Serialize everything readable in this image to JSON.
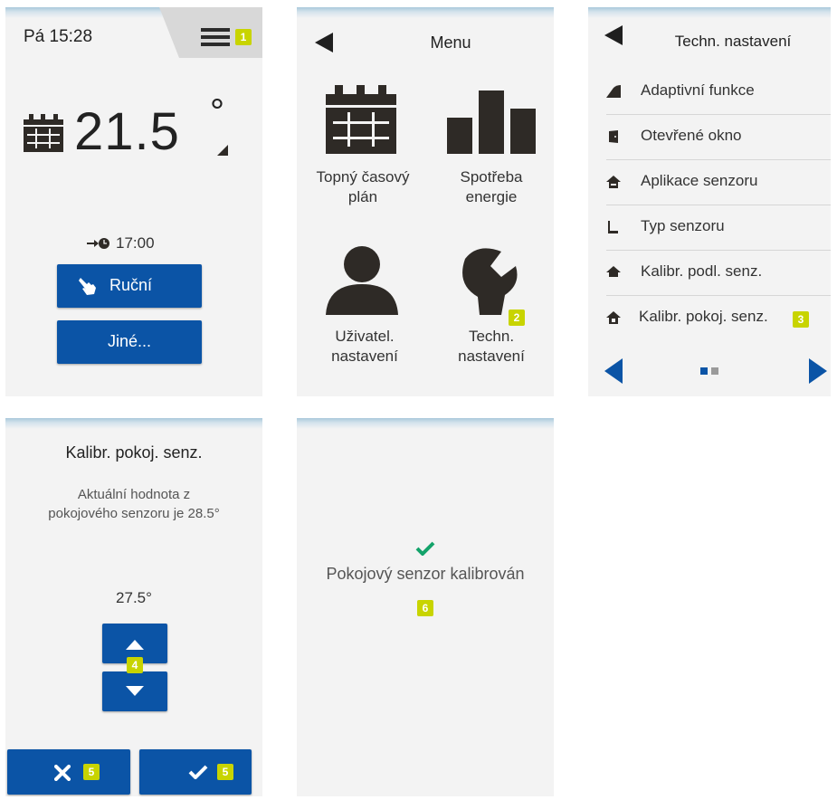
{
  "screen1": {
    "time": "Pá 15:28",
    "badge_menu": "1",
    "temperature": "21.5",
    "degree": "°",
    "next_change_time": "17:00",
    "manual_label": "Ruční",
    "other_label": "Jiné..."
  },
  "screen2": {
    "title": "Menu",
    "items": [
      {
        "label_line1": "Topný časový",
        "label_line2": "plán"
      },
      {
        "label_line1": "Spotřeba",
        "label_line2": "energie"
      },
      {
        "label_line1": "Uživatel.",
        "label_line2": "nastavení"
      },
      {
        "label_line1": "Techn.",
        "label_line2": "nastavení"
      }
    ],
    "badge_tech": "2"
  },
  "screen3": {
    "title": "Techn. nastavení",
    "items": [
      {
        "label": "Adaptivní funkce",
        "icon": "adaptive-icon"
      },
      {
        "label": "Otevřené okno",
        "icon": "door-icon"
      },
      {
        "label": "Aplikace senzoru",
        "icon": "house-sensor-icon"
      },
      {
        "label": "Typ senzoru",
        "icon": "sensor-type-icon"
      },
      {
        "label": "Kalibr. podl. senz.",
        "icon": "house-floor-icon"
      },
      {
        "label": "Kalibr. pokoj. senz.",
        "icon": "house-room-icon"
      }
    ],
    "badge_room_sensor": "3",
    "page_indicator": {
      "current": 1,
      "total": 2
    }
  },
  "screen4": {
    "title": "Kalibr. pokoj. senz.",
    "info_line1": "Aktuální hodnota z",
    "info_line2": "pokojového senzoru je 28.5°",
    "value": "27.5°",
    "badge_stepper": "4",
    "badge_cancel": "5",
    "badge_confirm": "5"
  },
  "screen5": {
    "message": "Pokojový senzor kalibrován",
    "badge_message": "6"
  },
  "colors": {
    "accent_blue": "#0b54a6",
    "badge_green": "#c8d400",
    "check_green": "#13a36a",
    "icon_dark": "#2e2a26"
  }
}
